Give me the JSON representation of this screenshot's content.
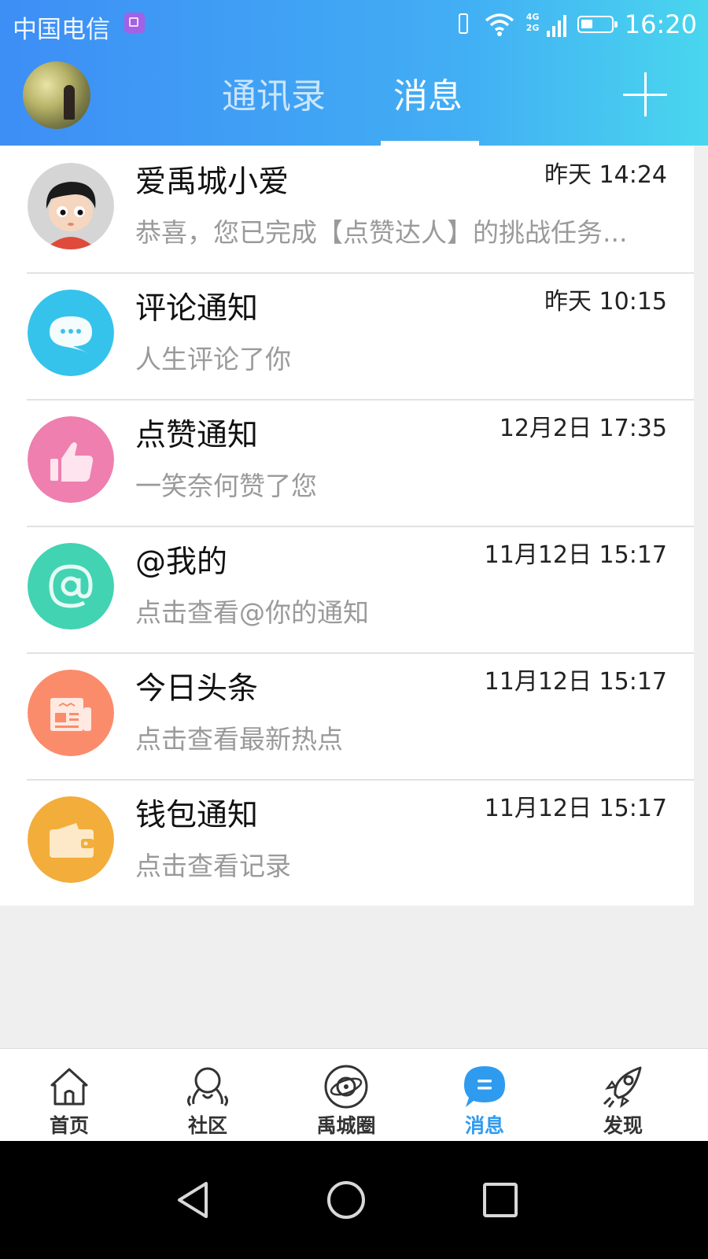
{
  "status_bar": {
    "carrier": "中国电信",
    "network": "4G",
    "network2": "2G",
    "time": "16:20",
    "icons": [
      "sim-card-icon",
      "vibrate-icon",
      "wifi-icon",
      "signal-icon",
      "battery-icon"
    ]
  },
  "header": {
    "tabs": [
      {
        "label": "通讯录",
        "active": false
      },
      {
        "label": "消息",
        "active": true
      }
    ],
    "avatar": "profile-avatar",
    "add_icon": "plus-icon"
  },
  "messages": [
    {
      "title": "爱禹城小爱",
      "time": "昨天 14:24",
      "preview": "恭喜，您已完成【点赞达人】的挑战任务...",
      "icon": "cartoon-avatar-icon",
      "color": "#d9d9d9"
    },
    {
      "title": "评论通知",
      "time": "昨天 10:15",
      "preview": "人生评论了你",
      "icon": "comment-bubble-icon",
      "color": "#36c3eb"
    },
    {
      "title": "点赞通知",
      "time": "12月2日 17:35",
      "preview": "一笑奈何赞了您",
      "icon": "thumbs-up-icon",
      "color": "#ee7fae"
    },
    {
      "title": "@我的",
      "time": "11月12日 15:17",
      "preview": "点击查看@你的通知",
      "icon": "at-sign-icon",
      "color": "#41d3b2"
    },
    {
      "title": "今日头条",
      "time": "11月12日 15:17",
      "preview": "点击查看最新热点",
      "icon": "newspaper-icon",
      "color": "#fb8c6b"
    },
    {
      "title": "钱包通知",
      "time": "11月12日 15:17",
      "preview": "点击查看记录",
      "icon": "wallet-icon",
      "color": "#f3ad3a"
    }
  ],
  "bottom_nav": [
    {
      "label": "首页",
      "icon": "home-icon",
      "active": false
    },
    {
      "label": "社区",
      "icon": "community-icon",
      "active": false
    },
    {
      "label": "禹城圈",
      "icon": "orbit-icon",
      "active": false
    },
    {
      "label": "消息",
      "icon": "message-icon",
      "active": true
    },
    {
      "label": "发现",
      "icon": "rocket-icon",
      "active": false
    }
  ],
  "system_nav": [
    "back-icon",
    "home-circle-icon",
    "recents-icon"
  ],
  "colors": {
    "accent": "#2f9bef",
    "header_start": "#3d8ef5",
    "header_end": "#49d6ee"
  }
}
